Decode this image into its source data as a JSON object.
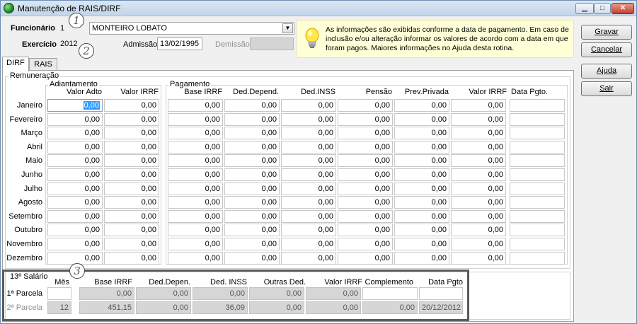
{
  "window": {
    "title": "Manutenção de RAIS/DIRF"
  },
  "header": {
    "funcionario_label": "Funcionário",
    "funcionario_code": "1",
    "funcionario_name": "MONTEIRO LOBATO",
    "exercicio_label": "Exercício",
    "exercicio_value": "2012",
    "admissao_label": "Admissão",
    "admissao_value": "13/02/1995",
    "demissao_label": "Demissão",
    "demissao_value": ""
  },
  "info_text": "As informações são exibidas conforme a data de pagamento. Em caso de inclusão e/ou alteração informar os valores de acordo com a data em que foram pagos. Maiores informações no Ajuda desta rotina.",
  "annotations": [
    "1",
    "2",
    "3"
  ],
  "buttons": {
    "gravar": "Gravar",
    "cancelar": "Cancelar",
    "ajuda": "Ajuda",
    "sair": "Sair"
  },
  "tabs": [
    "DIRF",
    "RAIS"
  ],
  "remuneracao": {
    "label": "Remuneração",
    "adiantamento_label": "Adiantamento",
    "pagamento_label": "Pagamento",
    "columns": [
      "Valor Adto",
      "Valor IRRF",
      "Base IRRF",
      "Ded.Depend.",
      "Ded.INSS",
      "Pensão",
      "Prev.Privada",
      "Valor IRRF",
      "Data Pgto."
    ],
    "months": [
      "Janeiro",
      "Fevereiro",
      "Março",
      "Abril",
      "Maio",
      "Junho",
      "Julho",
      "Agosto",
      "Setembro",
      "Outubro",
      "Novembro",
      "Dezembro"
    ],
    "rows": [
      [
        "0,00",
        "0,00",
        "0,00",
        "0,00",
        "0,00",
        "0,00",
        "0,00",
        "0,00",
        ""
      ],
      [
        "0,00",
        "0,00",
        "0,00",
        "0,00",
        "0,00",
        "0,00",
        "0,00",
        "0,00",
        ""
      ],
      [
        "0,00",
        "0,00",
        "0,00",
        "0,00",
        "0,00",
        "0,00",
        "0,00",
        "0,00",
        ""
      ],
      [
        "0,00",
        "0,00",
        "0,00",
        "0,00",
        "0,00",
        "0,00",
        "0,00",
        "0,00",
        ""
      ],
      [
        "0,00",
        "0,00",
        "0,00",
        "0,00",
        "0,00",
        "0,00",
        "0,00",
        "0,00",
        ""
      ],
      [
        "0,00",
        "0,00",
        "0,00",
        "0,00",
        "0,00",
        "0,00",
        "0,00",
        "0,00",
        ""
      ],
      [
        "0,00",
        "0,00",
        "0,00",
        "0,00",
        "0,00",
        "0,00",
        "0,00",
        "0,00",
        ""
      ],
      [
        "0,00",
        "0,00",
        "0,00",
        "0,00",
        "0,00",
        "0,00",
        "0,00",
        "0,00",
        ""
      ],
      [
        "0,00",
        "0,00",
        "0,00",
        "0,00",
        "0,00",
        "0,00",
        "0,00",
        "0,00",
        ""
      ],
      [
        "0,00",
        "0,00",
        "0,00",
        "0,00",
        "0,00",
        "0,00",
        "0,00",
        "0,00",
        ""
      ],
      [
        "0,00",
        "0,00",
        "0,00",
        "0,00",
        "0,00",
        "0,00",
        "0,00",
        "0,00",
        ""
      ],
      [
        "0,00",
        "0,00",
        "0,00",
        "0,00",
        "0,00",
        "0,00",
        "0,00",
        "0,00",
        ""
      ]
    ]
  },
  "decimo_terceiro": {
    "label": "13º Salário",
    "columns": [
      "Mês",
      "Base IRRF",
      "Ded.Depen.",
      "Ded. INSS",
      "Outras Ded.",
      "Valor IRRF",
      "Complemento",
      "Data Pgto"
    ],
    "rows": [
      {
        "label": "1ª Parcela",
        "values": [
          "",
          "0,00",
          "0,00",
          "0,00",
          "0,00",
          "0,00",
          "",
          ""
        ]
      },
      {
        "label": "2ª Parcela",
        "values": [
          "12",
          "451,15",
          "0,00",
          "36,09",
          "0,00",
          "0,00",
          "0,00",
          "20/12/2012"
        ]
      }
    ]
  }
}
